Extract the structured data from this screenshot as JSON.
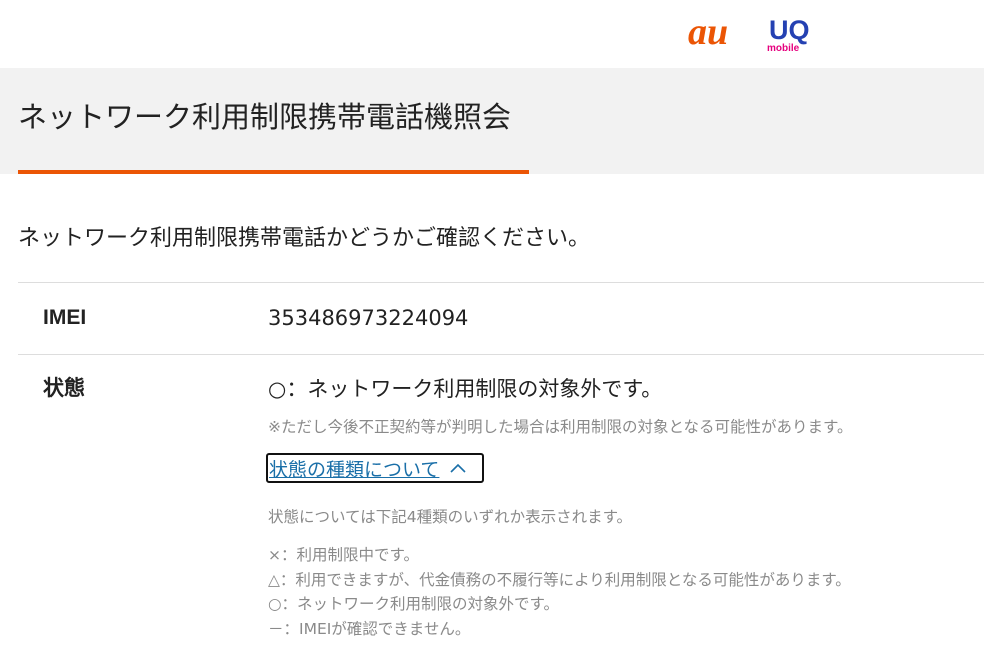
{
  "brand": {
    "au_logo_text": "au",
    "uq_logo_text": "UQ",
    "uq_logo_sub": "mobile",
    "au_color": "#eb5505",
    "uq_color": "#2541b2",
    "uq_sub_color": "#e6007e"
  },
  "page": {
    "title": "ネットワーク利用制限携帯電話機照会",
    "accent_color": "#eb5505",
    "intro": "ネットワーク利用制限携帯電話かどうかご確認ください。"
  },
  "result": {
    "imei_label": "IMEI",
    "imei_value": "353486973224094",
    "status_label": "状態",
    "status_value": "○：ネットワーク利用制限の対象外です。",
    "status_note": "※ただし今後不正契約等が判明した場合は利用制限の対象となる可能性があります。"
  },
  "status_types": {
    "toggle_label": "状態の種類について",
    "toggle_icon": "chevron-up-icon",
    "expanded": true,
    "description": "状態については下記4種類のいずれか表示されます。",
    "items": [
      "×：利用制限中です。",
      "△：利用できますが、代金債務の不履行等により利用制限となる可能性があります。",
      "○：ネットワーク利用制限の対象外です。",
      "－：IMEIが確認できません。"
    ]
  }
}
